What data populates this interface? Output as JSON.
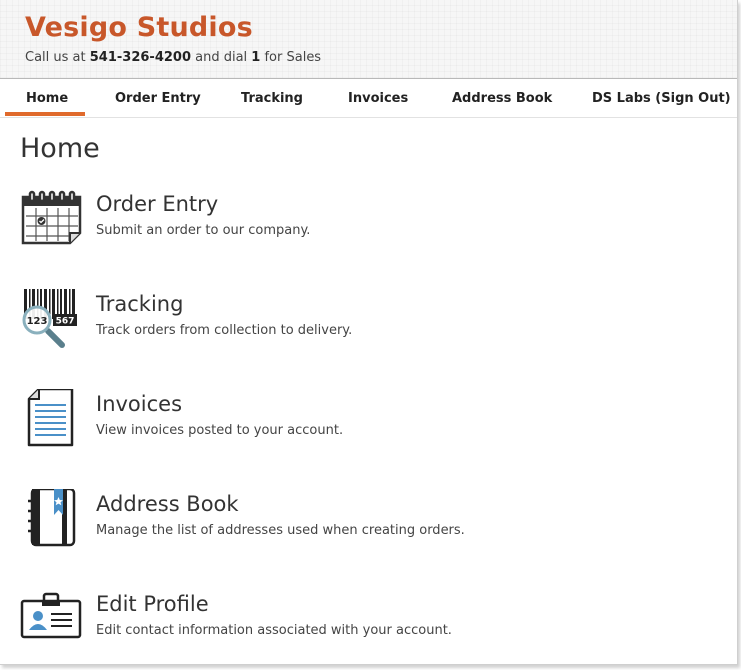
{
  "header": {
    "company_name": "Vesigo Studios",
    "call_prefix": "Call us at ",
    "phone": "541-326-4200",
    "call_middle": " and dial ",
    "dial": "1",
    "call_suffix": " for Sales"
  },
  "nav": {
    "items": [
      {
        "label": "Home",
        "active": true
      },
      {
        "label": "Order Entry",
        "active": false
      },
      {
        "label": "Tracking",
        "active": false
      },
      {
        "label": "Invoices",
        "active": false
      },
      {
        "label": "Address Book",
        "active": false
      },
      {
        "label": "DS Labs (Sign Out)",
        "active": false
      }
    ]
  },
  "page": {
    "title": "Home",
    "entries": [
      {
        "title": "Order Entry",
        "description": "Submit an order to our company.",
        "icon": "calendar-icon"
      },
      {
        "title": "Tracking",
        "description": "Track orders from collection to delivery.",
        "icon": "barcode-magnifier-icon"
      },
      {
        "title": "Invoices",
        "description": "View invoices posted to your account.",
        "icon": "document-icon"
      },
      {
        "title": "Address Book",
        "description": "Manage the list of addresses used when creating orders.",
        "icon": "address-book-icon"
      },
      {
        "title": "Edit Profile",
        "description": "Edit contact information associated with your account.",
        "icon": "id-card-icon"
      }
    ],
    "barcode_digits_left": "123",
    "barcode_digits_right": "567"
  },
  "colors": {
    "brand": "#c8572a",
    "accent": "#e06a2c",
    "icon_blue": "#4a90c8"
  }
}
